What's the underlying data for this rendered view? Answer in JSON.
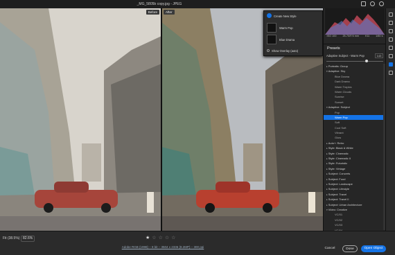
{
  "window": {
    "title": "_MG_5805b copy.jpg  -  JPEG"
  },
  "canvas": {
    "before_label": "Before",
    "after_label": "After"
  },
  "popup": {
    "create_label": "Create New Style",
    "styles": [
      {
        "name": "Warm Pop"
      },
      {
        "name": "Blue Drama"
      }
    ],
    "show_overlay_label": "Show Overlay (auto)"
  },
  "camera_info": [
    "ISO 100",
    "25-70/F/4 mm",
    "f/11",
    "1/60 s"
  ],
  "presets": {
    "title": "Presets",
    "current_label": "Adaptive Subject - Warm Pop",
    "amount": "143",
    "amount_fraction": 0.72,
    "items": [
      {
        "label": "Portraits: Group",
        "kind": "group"
      },
      {
        "label": "Adaptive: Sky",
        "kind": "group-open"
      },
      {
        "label": "Blue Drama",
        "kind": "child"
      },
      {
        "label": "Dark Drama",
        "kind": "child"
      },
      {
        "label": "Warm Tropics",
        "kind": "child"
      },
      {
        "label": "Warm Clouds",
        "kind": "child"
      },
      {
        "label": "Sunrise",
        "kind": "child"
      },
      {
        "label": "Sunset",
        "kind": "child"
      },
      {
        "label": "Adaptive: Subject",
        "kind": "group-open"
      },
      {
        "label": "Pop",
        "kind": "child"
      },
      {
        "label": "Warm Pop",
        "kind": "selected"
      },
      {
        "label": "Soft",
        "kind": "child"
      },
      {
        "label": "Cool Soft",
        "kind": "child"
      },
      {
        "label": "Vibrant",
        "kind": "child"
      },
      {
        "label": "Glow",
        "kind": "child"
      },
      {
        "label": "Auto+: Retro",
        "kind": "group"
      },
      {
        "label": "Style: Black & White",
        "kind": "group"
      },
      {
        "label": "Style: Cinematic",
        "kind": "group"
      },
      {
        "label": "Style: Cinematic II",
        "kind": "group"
      },
      {
        "label": "Style: Futuristic",
        "kind": "group"
      },
      {
        "label": "Style: Vintage",
        "kind": "group"
      },
      {
        "label": "Subject: Concerts",
        "kind": "group"
      },
      {
        "label": "Subject: Food",
        "kind": "group"
      },
      {
        "label": "Subject: Landscape",
        "kind": "group"
      },
      {
        "label": "Subject: Lifestyle",
        "kind": "group"
      },
      {
        "label": "Subject: Travel",
        "kind": "group"
      },
      {
        "label": "Subject: Travel II",
        "kind": "group"
      },
      {
        "label": "Subject: Urban Architecture",
        "kind": "group"
      },
      {
        "label": "Video: Creative",
        "kind": "group-open"
      },
      {
        "label": "VC/01",
        "kind": "child"
      },
      {
        "label": "VC/02",
        "kind": "child"
      },
      {
        "label": "VC/03",
        "kind": "child"
      },
      {
        "label": "VC/04",
        "kind": "child"
      }
    ]
  },
  "bottom": {
    "fit_label": "Fit (38.5%)",
    "zoom_value": "82.6%",
    "file_info": "Adobe RGB (1998) – 8 bit – 3504 x 2336 (8.2MP) – 300 ppi",
    "cancel": "Cancel",
    "done": "Done",
    "open_object": "Open Object"
  },
  "colors": {
    "accent": "#1473e6",
    "panel": "#262626",
    "background": "#1e1e1e"
  }
}
